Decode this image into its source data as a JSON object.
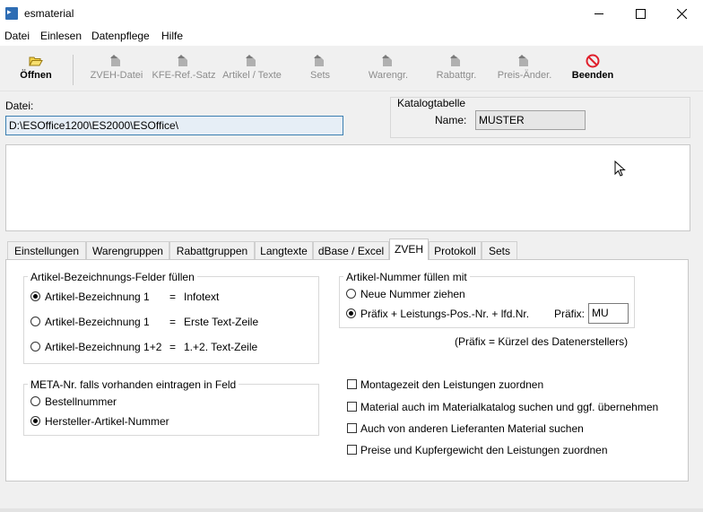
{
  "window": {
    "title": "esmaterial",
    "app_icon_glyph": "▸",
    "minimize_glyph": "—",
    "maximize_glyph": "□",
    "close_glyph": "✕"
  },
  "menu": [
    "Datei",
    "Einlesen",
    "Datenpflege",
    "Hilfe"
  ],
  "toolbar": {
    "open": "Öffnen",
    "zveh_datei": "ZVEH-Datei",
    "kfe_ref_satz": "KFE-Ref.-Satz",
    "artikel_texte": "Artikel / Texte",
    "sets": "Sets",
    "warengr": "Warengr.",
    "rabattgr": "Rabattgr.",
    "preis_aender": "Preis-Änder.",
    "beenden": "Beenden"
  },
  "datei": {
    "label": "Datei:",
    "value": "D:\\ESOffice1200\\ES2000\\ESOffice\\"
  },
  "katalog": {
    "title": "Katalogtabelle",
    "name_label": "Name:",
    "name_value": "MUSTER"
  },
  "tabs": [
    "Einstellungen",
    "Warengruppen",
    "Rabattgruppen",
    "Langtexte",
    "dBase / Excel",
    "ZVEH",
    "Protokoll",
    "Sets"
  ],
  "active_tab": "ZVEH",
  "zveh": {
    "bezeichnung_group": {
      "title": "Artikel-Bezeichnungs-Felder füllen",
      "options": [
        {
          "label": "Artikel-Bezeichnung 1",
          "eq": "=",
          "target": "Infotext",
          "checked": true
        },
        {
          "label": "Artikel-Bezeichnung 1",
          "eq": "=",
          "target": "Erste Text-Zeile",
          "checked": false
        },
        {
          "label": "Artikel-Bezeichnung 1+2",
          "eq": "=",
          "target": "1.+2. Text-Zeile",
          "checked": false
        }
      ]
    },
    "nummer_group": {
      "title": "Artikel-Nummer füllen mit",
      "options": [
        {
          "label": "Neue Nummer ziehen",
          "checked": false
        },
        {
          "label": "Präfix + Leistungs-Pos.-Nr. + lfd.Nr.",
          "checked": true
        }
      ],
      "praefix_label": "Präfix:",
      "praefix_value": "MU",
      "praefix_note": "(Präfix = Kürzel des Datenerstellers)"
    },
    "meta_group": {
      "title": "META-Nr. falls vorhanden eintragen in Feld",
      "options": [
        {
          "label": "Bestellnummer",
          "checked": false
        },
        {
          "label": "Hersteller-Artikel-Nummer",
          "checked": true
        }
      ]
    },
    "checkboxes": [
      {
        "label": "Montagezeit den Leistungen zuordnen",
        "checked": false
      },
      {
        "label": "Material auch im Materialkatalog suchen und ggf. übernehmen",
        "checked": false
      },
      {
        "label": "Auch von anderen Lieferanten Material suchen",
        "checked": false
      },
      {
        "label": "Preise und Kupfergewicht den Leistungen zuordnen",
        "checked": false
      }
    ]
  },
  "colors": {
    "accent": "#3c7fb1",
    "stop_red": "#e0202c",
    "folder_yellow": "#e8c21c"
  }
}
